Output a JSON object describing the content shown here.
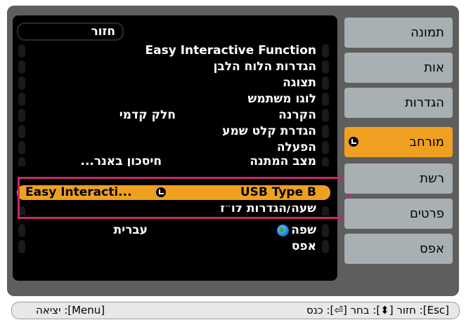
{
  "tabs": [
    {
      "label": "תמונה"
    },
    {
      "label": "אות"
    },
    {
      "label": "הגדרות"
    },
    {
      "label": "מורחב"
    },
    {
      "label": "רשת"
    },
    {
      "label": "פרטים"
    },
    {
      "label": "אפס"
    }
  ],
  "active_tab_index": 3,
  "submenu": {
    "back_label": "חזור",
    "items": [
      {
        "label": "Easy Interactive Function",
        "value": ""
      },
      {
        "label": "הגדרות הלוח הלבן",
        "value": ""
      },
      {
        "label": "תצוגה",
        "value": ""
      },
      {
        "label": "לוגו משתמש",
        "value": ""
      },
      {
        "label": "הקרנה",
        "value": "חלק קדמי"
      },
      {
        "label": "הגדרת קלט שמע",
        "value": ""
      },
      {
        "label": "הפעלה",
        "value": ""
      },
      {
        "label": "מצב המתנה",
        "value": "חיסכון באנר..."
      },
      {
        "label": "USB Type B",
        "value": "Easy Interacti..."
      },
      {
        "label": "שעה/הגדרות לו\"ז",
        "value": ""
      },
      {
        "label": "שפה",
        "value": "עברית"
      },
      {
        "label": "אפס",
        "value": ""
      }
    ],
    "selected_index": 8
  },
  "help_bar": {
    "nav_hint": "[Esc]: חזור [⬍]: בחר [⏎]: כנס",
    "exit_hint": "[Menu]: יציאה"
  },
  "colors": {
    "accent": "#f0a020",
    "frame": "#5e5e5e",
    "tab_bg": "#a9b0b3",
    "highlight_box": "#c8286c"
  }
}
